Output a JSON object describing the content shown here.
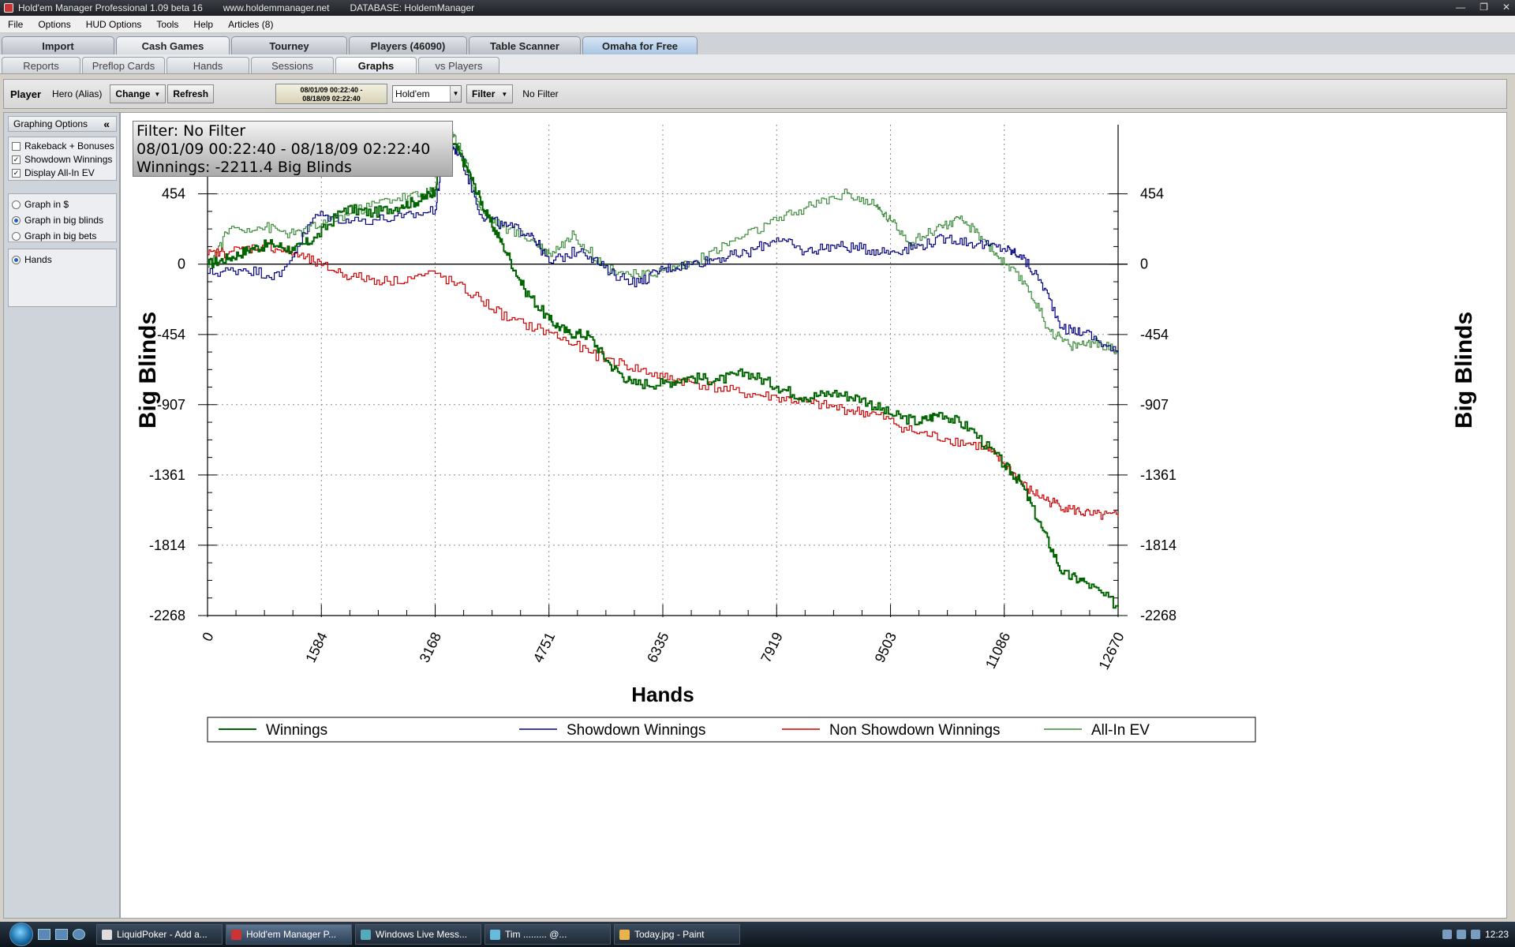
{
  "window": {
    "title": "Hold'em Manager Professional 1.09 beta 16",
    "website": "www.holdemmanager.net",
    "database": "DATABASE: HoldemManager",
    "controls": [
      "—",
      "❐",
      "✕"
    ]
  },
  "menu": [
    "File",
    "Options",
    "HUD Options",
    "Tools",
    "Help",
    "Articles (8)"
  ],
  "main_tabs": [
    "Import",
    "Cash Games",
    "Tourney",
    "Players (46090)",
    "Table Scanner",
    "Omaha for Free"
  ],
  "sub_tabs": [
    "Reports",
    "Preflop Cards",
    "Hands",
    "Sessions",
    "Graphs",
    "vs Players"
  ],
  "toolbar": {
    "player_label": "Player",
    "player_value": "Hero (Alias)",
    "change_label": "Change",
    "refresh_label": "Refresh",
    "date_line1": "08/01/09 00:22:40 -",
    "date_line2": "08/18/09 02:22:40",
    "game_select": "Hold'em",
    "filter_label": "Filter",
    "filter_value": "No Filter"
  },
  "sidebar": {
    "header": "Graphing Options",
    "collapse_glyph": "«",
    "checkboxes": [
      {
        "label": "Rakeback + Bonuses",
        "checked": false
      },
      {
        "label": "Showdown Winnings",
        "checked": true
      },
      {
        "label": "Display All-In EV",
        "checked": true
      }
    ],
    "radios": [
      {
        "label": "Graph in $",
        "checked": false
      },
      {
        "label": "Graph in big blinds",
        "checked": true
      },
      {
        "label": "Graph in big bets",
        "checked": false
      }
    ],
    "xaxis_radio": {
      "label": "Hands",
      "checked": true
    }
  },
  "infobox": {
    "filter": "Filter: No Filter",
    "range": "08/01/09 00:22:40 - 08/18/09 02:22:40",
    "winnings": "Winnings: -2211.4 Big Blinds"
  },
  "chart_data": {
    "type": "line",
    "xlabel": "Hands",
    "ylabel": "Big Blinds",
    "xlim": [
      0,
      12670
    ],
    "ylim": [
      -2268,
      900
    ],
    "x_ticks": [
      "0",
      "1584",
      "3168",
      "4751",
      "6335",
      "7919",
      "9503",
      "11086",
      "12670"
    ],
    "y_ticks": [
      "454",
      "0",
      "-454",
      "-907",
      "-1361",
      "-1814",
      "-2268"
    ],
    "grid": true,
    "legend_position": "bottom",
    "series": [
      {
        "name": "Winnings",
        "color": "#006400",
        "points": [
          [
            0,
            0
          ],
          [
            300,
            40
          ],
          [
            600,
            100
          ],
          [
            900,
            130
          ],
          [
            1200,
            90
          ],
          [
            1500,
            170
          ],
          [
            1900,
            360
          ],
          [
            2300,
            330
          ],
          [
            2700,
            380
          ],
          [
            3000,
            420
          ],
          [
            3168,
            480
          ],
          [
            3300,
            850
          ],
          [
            3500,
            720
          ],
          [
            3700,
            520
          ],
          [
            3900,
            300
          ],
          [
            4100,
            130
          ],
          [
            4400,
            -160
          ],
          [
            4751,
            -360
          ],
          [
            5000,
            -440
          ],
          [
            5300,
            -460
          ],
          [
            5600,
            -650
          ],
          [
            5900,
            -770
          ],
          [
            6335,
            -770
          ],
          [
            6700,
            -730
          ],
          [
            7100,
            -750
          ],
          [
            7500,
            -700
          ],
          [
            7919,
            -790
          ],
          [
            8300,
            -860
          ],
          [
            8700,
            -830
          ],
          [
            9100,
            -870
          ],
          [
            9503,
            -970
          ],
          [
            9900,
            -1020
          ],
          [
            10200,
            -960
          ],
          [
            10600,
            -1060
          ],
          [
            11086,
            -1300
          ],
          [
            11300,
            -1400
          ],
          [
            11600,
            -1700
          ],
          [
            11900,
            -2000
          ],
          [
            12200,
            -2050
          ],
          [
            12670,
            -2211
          ]
        ]
      },
      {
        "name": "Showdown Winnings",
        "color": "#000080",
        "points": [
          [
            0,
            -60
          ],
          [
            500,
            -30
          ],
          [
            1000,
            -80
          ],
          [
            1500,
            320
          ],
          [
            2000,
            280
          ],
          [
            2700,
            300
          ],
          [
            3168,
            350
          ],
          [
            3300,
            790
          ],
          [
            3500,
            720
          ],
          [
            3800,
            320
          ],
          [
            4100,
            250
          ],
          [
            4500,
            200
          ],
          [
            4751,
            10
          ],
          [
            5200,
            100
          ],
          [
            5600,
            -60
          ],
          [
            6000,
            -120
          ],
          [
            6335,
            -30
          ],
          [
            6700,
            0
          ],
          [
            7100,
            40
          ],
          [
            7500,
            70
          ],
          [
            7919,
            170
          ],
          [
            8300,
            80
          ],
          [
            8700,
            120
          ],
          [
            9100,
            100
          ],
          [
            9503,
            80
          ],
          [
            9900,
            120
          ],
          [
            10300,
            170
          ],
          [
            10700,
            130
          ],
          [
            11086,
            100
          ],
          [
            11300,
            60
          ],
          [
            11600,
            -120
          ],
          [
            11900,
            -420
          ],
          [
            12200,
            -440
          ],
          [
            12670,
            -580
          ]
        ]
      },
      {
        "name": "Non Showdown Winnings",
        "color": "#cc0000",
        "points": [
          [
            0,
            60
          ],
          [
            300,
            80
          ],
          [
            800,
            120
          ],
          [
            1200,
            70
          ],
          [
            1584,
            -10
          ],
          [
            2000,
            -80
          ],
          [
            2500,
            -110
          ],
          [
            3168,
            -60
          ],
          [
            3700,
            -200
          ],
          [
            4200,
            -360
          ],
          [
            4751,
            -440
          ],
          [
            5300,
            -570
          ],
          [
            5800,
            -650
          ],
          [
            6335,
            -730
          ],
          [
            6800,
            -770
          ],
          [
            7400,
            -830
          ],
          [
            7919,
            -860
          ],
          [
            8400,
            -900
          ],
          [
            8900,
            -940
          ],
          [
            9300,
            -970
          ],
          [
            9800,
            -1080
          ],
          [
            10300,
            -1130
          ],
          [
            10800,
            -1180
          ],
          [
            11086,
            -1290
          ],
          [
            11400,
            -1450
          ],
          [
            11700,
            -1530
          ],
          [
            12000,
            -1580
          ],
          [
            12300,
            -1620
          ],
          [
            12670,
            -1630
          ]
        ]
      },
      {
        "name": "All-In EV",
        "color": "#3c8c3c",
        "points": [
          [
            0,
            -20
          ],
          [
            300,
            230
          ],
          [
            800,
            240
          ],
          [
            1200,
            190
          ],
          [
            1584,
            260
          ],
          [
            2000,
            330
          ],
          [
            2500,
            420
          ],
          [
            3000,
            450
          ],
          [
            3168,
            480
          ],
          [
            3300,
            860
          ],
          [
            3500,
            780
          ],
          [
            3800,
            350
          ],
          [
            4100,
            240
          ],
          [
            4500,
            160
          ],
          [
            4751,
            70
          ],
          [
            5100,
            190
          ],
          [
            5500,
            -10
          ],
          [
            6000,
            -80
          ],
          [
            6335,
            -40
          ],
          [
            6800,
            20
          ],
          [
            7300,
            150
          ],
          [
            7919,
            280
          ],
          [
            8400,
            380
          ],
          [
            8900,
            460
          ],
          [
            9300,
            370
          ],
          [
            9503,
            280
          ],
          [
            9800,
            140
          ],
          [
            10200,
            250
          ],
          [
            10500,
            280
          ],
          [
            10800,
            160
          ],
          [
            11086,
            0
          ],
          [
            11400,
            -140
          ],
          [
            11700,
            -420
          ],
          [
            12000,
            -530
          ],
          [
            12300,
            -500
          ],
          [
            12670,
            -560
          ]
        ]
      }
    ]
  },
  "taskbar": {
    "buttons": [
      "LiquidPoker - Add a...",
      "Hold'em Manager P...",
      "Windows Live Mess...",
      "Tim ......... @...",
      "Today.jpg - Paint"
    ],
    "active_index": 1,
    "clock": "12:23"
  }
}
